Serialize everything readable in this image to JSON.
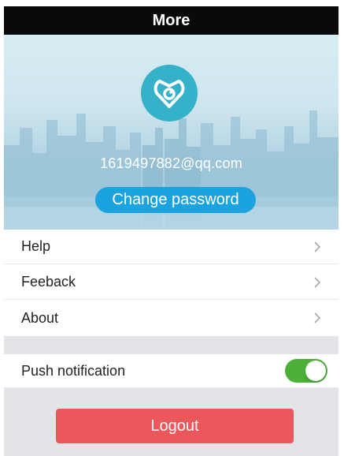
{
  "title": "More",
  "profile": {
    "email": "1619497882@qq.com",
    "change_password_label": "Change password"
  },
  "menu": {
    "items": [
      {
        "label": "Help"
      },
      {
        "label": "Feeback"
      },
      {
        "label": "About"
      }
    ]
  },
  "push_notification": {
    "label": "Push notification",
    "enabled": true
  },
  "logout_label": "Logout",
  "colors": {
    "title_bar": "#0a0a0a",
    "avatar": "#35b2c9",
    "change_password_button": "#1ba3e0",
    "toggle_on": "#4ab037",
    "logout_button": "#eb585c",
    "section_gap": "#e3e3e8"
  },
  "icons": {
    "avatar": "shield-heart-icon",
    "menu_chevron": "chevron-right-icon"
  }
}
